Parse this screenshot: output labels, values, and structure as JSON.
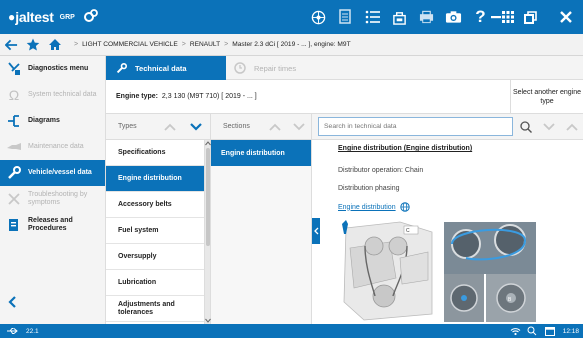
{
  "app": {
    "logo_text": "jaltest",
    "logo_sub": "GRP"
  },
  "breadcrumb": {
    "items": [
      "LIGHT COMMERCIAL VEHICLE",
      "RENAULT",
      "Master 2.3 dCi [ 2019 - ... ], engine: M9T"
    ]
  },
  "sidebar": {
    "items": [
      {
        "label": "Diagnostics menu",
        "state": "normal",
        "icon": "diagnostics-icon"
      },
      {
        "label": "System technical data",
        "state": "disabled",
        "icon": "omega-icon"
      },
      {
        "label": "Diagrams",
        "state": "normal",
        "icon": "diagrams-icon"
      },
      {
        "label": "Maintenance data",
        "state": "disabled",
        "icon": "maintenance-icon"
      },
      {
        "label": "Vehicle/vessel data",
        "state": "active",
        "icon": "wrench-icon"
      },
      {
        "label": "Troubleshooting by symptoms",
        "state": "disabled",
        "icon": "troubleshooting-icon"
      },
      {
        "label": "Releases and Procedures",
        "state": "normal",
        "icon": "procedures-icon"
      }
    ]
  },
  "tabs": {
    "active": "Technical data",
    "inactive": "Repair times"
  },
  "engine": {
    "label": "Engine type:",
    "value": "2,3 130 (M9T 710) [ 2019 - ... ]",
    "select_another": "Select another engine type"
  },
  "columns": {
    "types_title": "Types",
    "sections_title": "Sections",
    "search_placeholder": "Search in technical data"
  },
  "types": [
    "Specifications",
    "Engine distribution",
    "Accessory belts",
    "Fuel system",
    "Oversupply",
    "Lubrication",
    "Adjustments and tolerances"
  ],
  "selected_type": "Engine distribution",
  "sections": [
    "Engine distribution"
  ],
  "content": {
    "title": "Engine distribution (Engine distribution)",
    "line1": "Distributor operation: Chain",
    "line2": "Distribution phasing",
    "link": "Engine distribution"
  },
  "status": {
    "version": "22.1",
    "time": "12:18"
  },
  "colors": {
    "brand": "#0b72b9",
    "sidebar_bg": "#f4f4f4",
    "disabled_text": "#b3b3b3"
  }
}
